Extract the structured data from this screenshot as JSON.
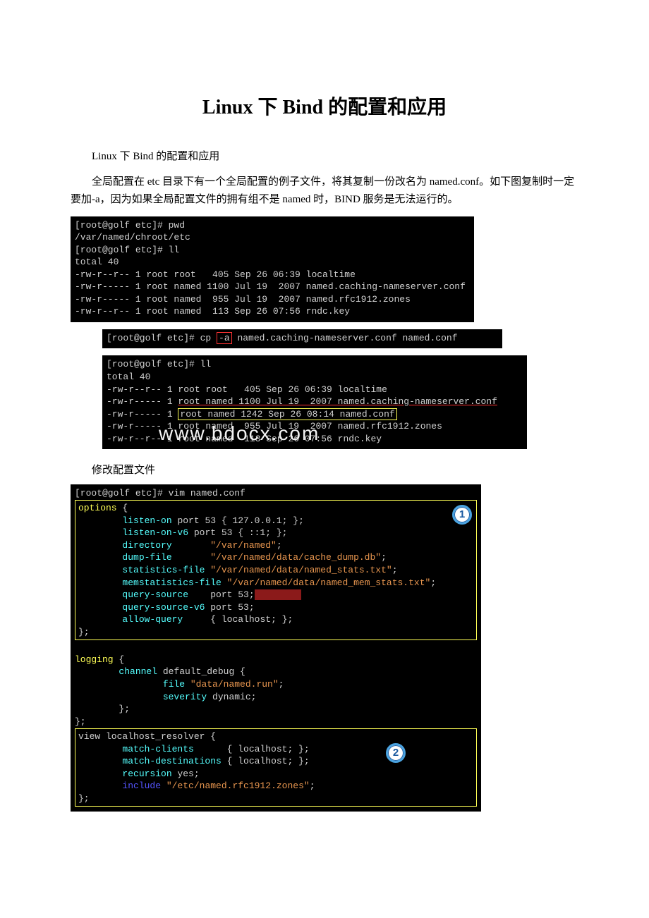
{
  "title": "Linux 下 Bind 的配置和应用",
  "intro1": "Linux 下 Bind 的配置和应用",
  "intro2": "全局配置在 etc 目录下有一个全局配置的例子文件，将其复制一份改名为 named.conf。如下图复制时一定要加-a，因为如果全局配置文件的拥有组不是 named 时，BIND 服务是无法运行的。",
  "term1": {
    "l1": "[root@golf etc]# pwd",
    "l2": "/var/named/chroot/etc",
    "l3": "[root@golf etc]# ll",
    "l4": "total 40",
    "l5a": "-rw-r--r-- 1 root root   405 Sep 26 06:39 ",
    "l5f": "localtime",
    "l6a": "-rw-r----- 1 root named 1100 Jul 19  2007 ",
    "l6f": "named.caching-nameserver.conf",
    "l7a": "-rw-r----- 1 root named  955 Jul 19  2007 ",
    "l7f": "named.rfc1912.zones",
    "l8a": "-rw-r--r-- 1 root named  113 Sep 26 07:56 ",
    "l8f": "rndc.key"
  },
  "term2": {
    "l1a": "[root@golf etc]# cp ",
    "flag": "-a",
    "l1b": " named.caching-nameserver.conf named.conf"
  },
  "term3": {
    "l1": "[root@golf etc]# ll",
    "l2": "total 40",
    "l3a": "-rw-r--r-- 1 root root   405 Sep 26 06:39 ",
    "l3f": "localtime",
    "l4a": "-rw-r----- 1 ",
    "l4u": "root named 1100 Jul 19  2007 named.caching-",
    "l4f": "nameserver.conf",
    "l5a": "-rw-r----- 1 ",
    "l5box": "root named 1242 Sep 26 08:14 named.conf",
    "l6a": "-rw-r----- 1 ",
    "l6mid": "root named  955 Jul 19  2007 ",
    "l6f": "named.rfc1912.zones",
    "l7a": "-rw-r--r-- 1 root named  113 Sep 26 07:56 ",
    "l7f": "rndc.key"
  },
  "caption_modify": "修改配置文件",
  "term4": {
    "header": "[root@golf etc]# vim named.conf",
    "opt_open": "options {",
    "opt1a": "        listen-on port 53 { 127.0.0.1; };",
    "opt2a": "        listen-on-v6 port 53 { ::1; };",
    "opt3a": "        directory       \"/var/named\";",
    "opt4a": "        dump-file       \"/var/named/data/cache_dump.db\";",
    "opt5a": "        statistics-file \"/var/named/data/named_stats.txt\";",
    "opt6a": "        memstatistics-file \"/var/named/data/named_mem_stats.txt\";",
    "opt7a": "        query-source    port 53;",
    "opt8a": "        query-source-v6 port 53;",
    "opt9a": "        allow-query     { localhost; };",
    "opt_close": "};",
    "log_open": "logging {",
    "log1": "        channel default_debug {",
    "log2": "                file \"data/named.run\";",
    "log3": "                severity dynamic;",
    "log4": "        };",
    "log_close": "};",
    "view_open": "view localhost_resolver {",
    "view1": "        match-clients      { localhost; };",
    "view2": "        match-destinations { localhost; };",
    "view3": "        recursion yes;",
    "view4a": "        ",
    "view4b": "include ",
    "view4c": "\"/etc/named.rfc1912.zones\";",
    "view_close": "};",
    "badge1": "1",
    "badge2": "2"
  },
  "watermark": "www.bdocx.com"
}
